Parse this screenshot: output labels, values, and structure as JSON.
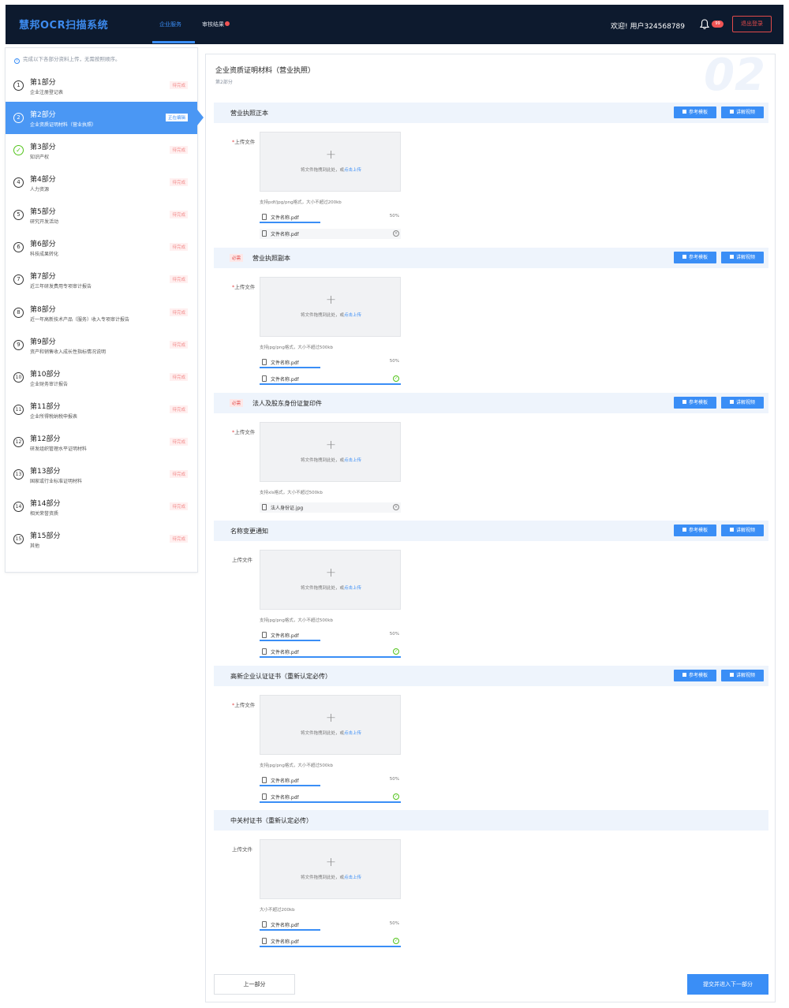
{
  "header": {
    "logo": "慧邦OCR扫描系统",
    "nav": [
      {
        "label": "企业服务"
      },
      {
        "label": "审核结果"
      }
    ],
    "welcome": "欢迎!   用户324568789",
    "notification_count": "99",
    "logout": "退出登录"
  },
  "sidebar": {
    "hint": "完成以下各部分资料上传，无需按照顺序。",
    "steps": [
      {
        "num": "1",
        "title": "第1部分",
        "sub": "企业注册登记表",
        "badge": "待完成"
      },
      {
        "num": "2",
        "title": "第2部分",
        "sub": "企业资质证明材料（营业执照）",
        "badge": "正在编辑"
      },
      {
        "num": "✓",
        "title": "第3部分",
        "sub": "知识产权",
        "badge": "待完成"
      },
      {
        "num": "4",
        "title": "第4部分",
        "sub": "人力资源",
        "badge": "待完成"
      },
      {
        "num": "5",
        "title": "第5部分",
        "sub": "研究开发活动",
        "badge": "待完成"
      },
      {
        "num": "6",
        "title": "第6部分",
        "sub": "科技成果转化",
        "badge": "待完成"
      },
      {
        "num": "7",
        "title": "第7部分",
        "sub": "近三年研发费用专项审计报告",
        "badge": "待完成"
      },
      {
        "num": "8",
        "title": "第8部分",
        "sub": "近一年高新技术产品（服务）收入专项审计报告",
        "badge": "待完成"
      },
      {
        "num": "9",
        "title": "第9部分",
        "sub": "资产和销售收入成长性指标情况说明",
        "badge": "待完成"
      },
      {
        "num": "10",
        "title": "第10部分",
        "sub": "企业财务审计报告",
        "badge": "待完成"
      },
      {
        "num": "11",
        "title": "第11部分",
        "sub": "企业所得税纳税申报表",
        "badge": "待完成"
      },
      {
        "num": "12",
        "title": "第12部分",
        "sub": "研发组织管理水平证明材料",
        "badge": "待完成"
      },
      {
        "num": "13",
        "title": "第13部分",
        "sub": "国家或行业标准证明材料",
        "badge": "待完成"
      },
      {
        "num": "14",
        "title": "第14部分",
        "sub": "相关荣誉资质",
        "badge": "待完成"
      },
      {
        "num": "15",
        "title": "第15部分",
        "sub": "其他",
        "badge": "待完成"
      }
    ]
  },
  "main": {
    "title": "企业资质证明材料（营业执照）",
    "subtitle": "第2部分",
    "watermark": "02",
    "common": {
      "ref_btn": "参考模板",
      "video_btn": "讲解视频",
      "upload_label": "上传文件",
      "star": "*",
      "plus": "+",
      "drop_text": "将文件拖拽到此处，或",
      "drop_link": "点击上传",
      "required_tag": "必需",
      "pct": "50%",
      "ok": "✓",
      "x": "×"
    },
    "sections": [
      {
        "title": "营业执照正本",
        "format": "支持pdf/jpg/png格式，大小不超过200kb",
        "files": [
          "文件名称.pdf",
          "文件名称.pdf"
        ]
      },
      {
        "title": "营业执照副本",
        "format": "支持jpg/png格式，大小不超过500kb",
        "files": [
          "文件名称.pdf",
          "文件名称.pdf"
        ]
      },
      {
        "title": "法人及股东身份证复印件",
        "format": "支持xls格式，大小不超过500kb",
        "files": [
          "法人身份证.jpg"
        ]
      },
      {
        "title": "名称变更通知",
        "format": "支持jpg/png格式，大小不超过500kb",
        "files": [
          "文件名称.pdf",
          "文件名称.pdf"
        ]
      },
      {
        "title": "高新企业认证证书（重新认定必传）",
        "format": "支持jpg/png格式，大小不超过500kb",
        "files": [
          "文件名称.pdf",
          "文件名称.pdf"
        ]
      },
      {
        "title": "中关村证书（重新认定必传）",
        "format": "大小不超过200kb",
        "files": [
          "文件名称.pdf",
          "文件名称.pdf"
        ]
      }
    ],
    "prev_btn": "上一部分",
    "next_btn": "提交并进入下一部分"
  },
  "colors": {
    "header_bg": "#0d1a2e",
    "accent": "#3a8ef6",
    "success": "#52c41a",
    "danger": "#e14a4a"
  }
}
